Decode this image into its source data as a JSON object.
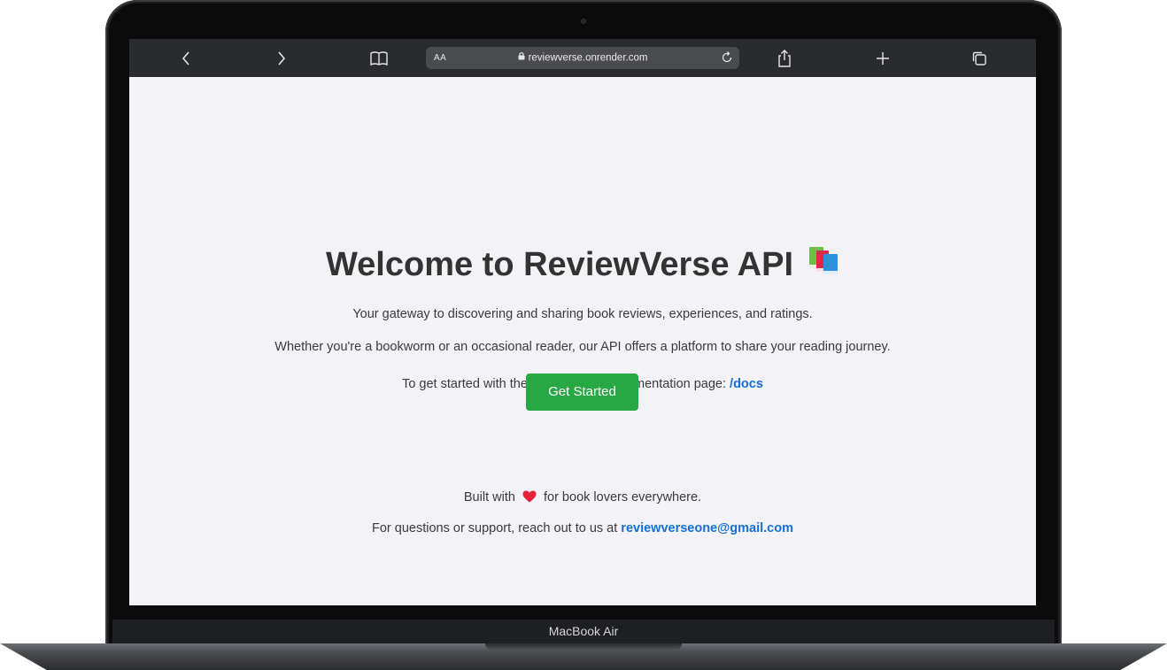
{
  "browser": {
    "reader_label": "AA",
    "url": "reviewverse.onrender.com"
  },
  "page": {
    "title": "Welcome to ReviewVerse API",
    "tagline": "Your gateway to discovering and sharing book reviews, experiences, and ratings.",
    "description": "Whether you're a bookworm or an occasional reader, our API offers a platform to share your reading journey.",
    "docs_prefix": "To get started with the API, visit our documentation page: ",
    "docs_link": "/docs",
    "cta_label": "Get Started",
    "built_prefix": "Built with",
    "built_suffix": "for book lovers everywhere.",
    "support_prefix": "For questions or support, reach out to us at ",
    "support_email": "reviewverseone@gmail.com"
  },
  "device": {
    "label": "MacBook Air"
  },
  "colors": {
    "accent_link": "#1570d6",
    "button": "#28a745",
    "page_bg": "#f3f2f7"
  },
  "icons": [
    "back-icon",
    "forward-icon",
    "bookmarks-icon",
    "lock-icon",
    "reload-icon",
    "share-icon",
    "new-tab-icon",
    "tabs-icon",
    "books-icon",
    "heart-icon"
  ]
}
